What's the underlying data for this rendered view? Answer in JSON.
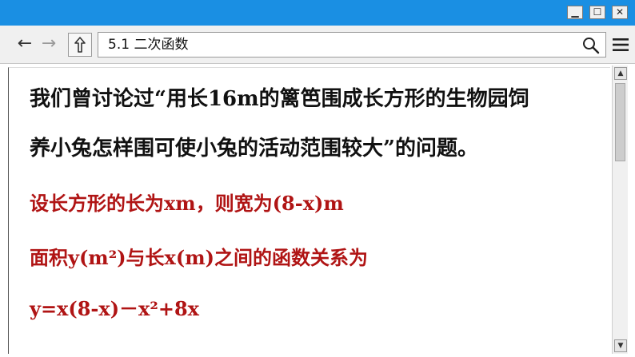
{
  "window": {
    "controls": {
      "minimize": "▁",
      "maximize": "☐",
      "close": "✕"
    }
  },
  "toolbar": {
    "back_icon": "←",
    "forward_icon": "→",
    "up_icon": "🡑",
    "address": "5.1 二次函数"
  },
  "content": {
    "line1": "我们曾讨论过“用长16m的篱笆围成长方形的生物园饲",
    "line2": "养小兔怎样围可使小兔的活动范围较大”的问题。",
    "line3": "设长方形的长为xm，则宽为(8-x)m",
    "line4": "面积y(m²)与长x(m)之间的函数关系为",
    "line5": "y=x(8-x)－x²+8x"
  },
  "colors": {
    "titlebar": "#1a8fe3",
    "text_black": "#111111",
    "text_red": "#b01414"
  },
  "icons": {
    "search": "search-icon",
    "menu": "menu-icon"
  }
}
